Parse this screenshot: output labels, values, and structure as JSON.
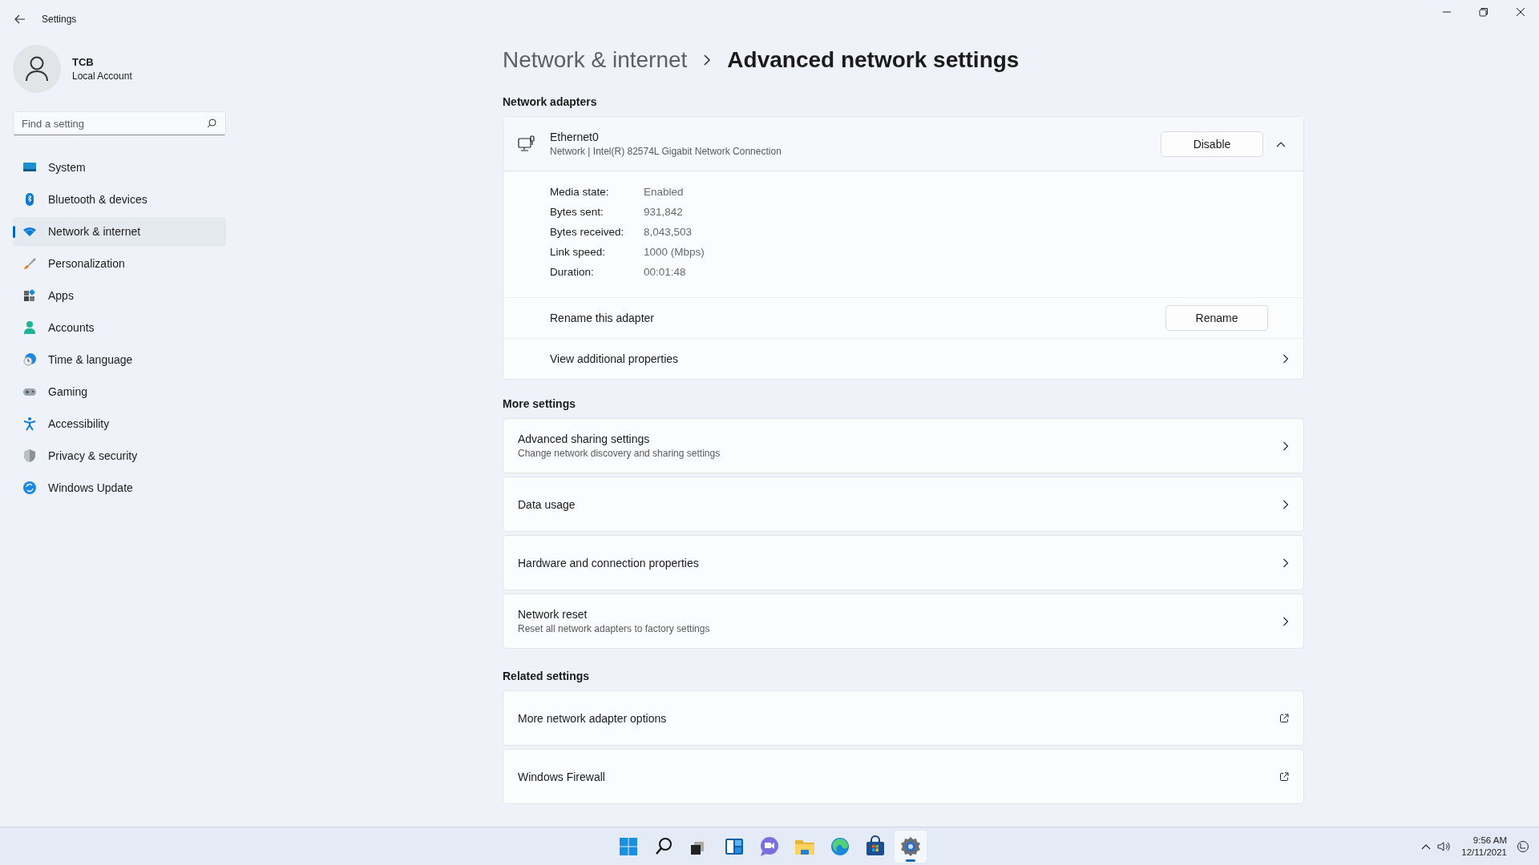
{
  "window": {
    "title": "Settings"
  },
  "account": {
    "name": "TCB",
    "type": "Local Account"
  },
  "search": {
    "placeholder": "Find a setting"
  },
  "nav": [
    {
      "label": "System",
      "selected": false
    },
    {
      "label": "Bluetooth & devices",
      "selected": false
    },
    {
      "label": "Network & internet",
      "selected": true
    },
    {
      "label": "Personalization",
      "selected": false
    },
    {
      "label": "Apps",
      "selected": false
    },
    {
      "label": "Accounts",
      "selected": false
    },
    {
      "label": "Time & language",
      "selected": false
    },
    {
      "label": "Gaming",
      "selected": false
    },
    {
      "label": "Accessibility",
      "selected": false
    },
    {
      "label": "Privacy & security",
      "selected": false
    },
    {
      "label": "Windows Update",
      "selected": false
    }
  ],
  "breadcrumb": {
    "parent": "Network & internet",
    "current": "Advanced network settings"
  },
  "adapters": {
    "heading": "Network adapters",
    "adapter": {
      "name": "Ethernet0",
      "description": "Network | Intel(R) 82574L Gigabit Network Connection",
      "button": "Disable",
      "expanded": true,
      "details": [
        {
          "label": "Media state:",
          "value": "Enabled"
        },
        {
          "label": "Bytes sent:",
          "value": "931,842"
        },
        {
          "label": "Bytes received:",
          "value": "8,043,503"
        },
        {
          "label": "Link speed:",
          "value": "1000 (Mbps)"
        },
        {
          "label": "Duration:",
          "value": "00:01:48"
        }
      ],
      "rows": [
        {
          "kind": "button",
          "label": "Rename this adapter",
          "button": "Rename"
        },
        {
          "kind": "link",
          "label": "View additional properties"
        }
      ]
    }
  },
  "more_settings": {
    "heading": "More settings",
    "items": [
      {
        "kind": "link",
        "title": "Advanced sharing settings",
        "subtitle": "Change network discovery and sharing settings"
      },
      {
        "kind": "link",
        "title": "Data usage"
      },
      {
        "kind": "link",
        "title": "Hardware and connection properties"
      },
      {
        "kind": "link",
        "title": "Network reset",
        "subtitle": "Reset all network adapters to factory settings"
      }
    ]
  },
  "related_settings": {
    "heading": "Related settings",
    "items": [
      {
        "kind": "external",
        "title": "More network adapter options"
      },
      {
        "kind": "external",
        "title": "Windows Firewall"
      }
    ]
  },
  "taskbar": {
    "apps": [
      {
        "selected": false
      },
      {
        "selected": false
      },
      {
        "selected": false
      },
      {
        "selected": false
      },
      {
        "selected": false
      },
      {
        "selected": false
      },
      {
        "selected": false
      },
      {
        "selected": false
      },
      {
        "selected": true
      }
    ],
    "time": "9:56 AM",
    "date": "12/11/2021"
  }
}
